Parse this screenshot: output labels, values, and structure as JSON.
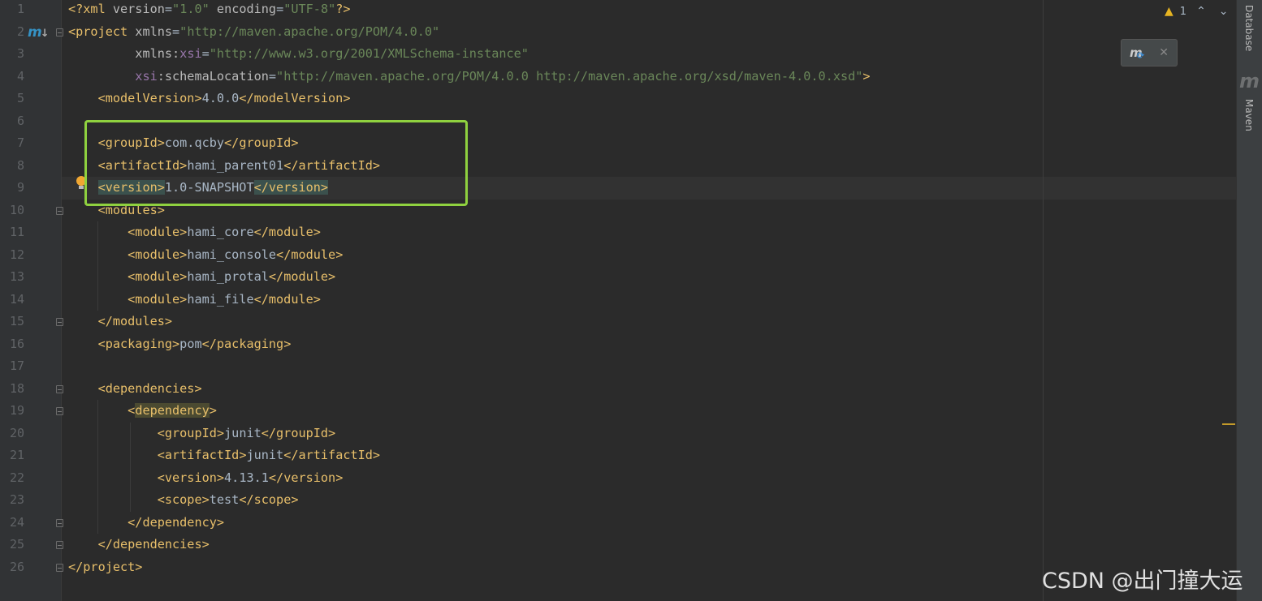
{
  "editor": {
    "lines": [
      {
        "num": "1",
        "parts": [
          {
            "c": "tag",
            "t": "<?xml "
          },
          {
            "c": "attr",
            "t": "version"
          },
          {
            "c": "txt",
            "t": "="
          },
          {
            "c": "val",
            "t": "\"1.0\""
          },
          {
            "c": "txt",
            "t": " "
          },
          {
            "c": "attr",
            "t": "encoding"
          },
          {
            "c": "txt",
            "t": "="
          },
          {
            "c": "val",
            "t": "\"UTF-8\""
          },
          {
            "c": "tag",
            "t": "?>"
          }
        ]
      },
      {
        "num": "2",
        "parts": [
          {
            "c": "tag",
            "t": "<project "
          },
          {
            "c": "attr",
            "t": "xmlns"
          },
          {
            "c": "txt",
            "t": "="
          },
          {
            "c": "val",
            "t": "\"http://maven.apache.org/POM/4.0.0\""
          }
        ]
      },
      {
        "num": "3",
        "parts": [
          {
            "c": "txt",
            "t": "         "
          },
          {
            "c": "attr",
            "t": "xmlns:"
          },
          {
            "c": "ns",
            "t": "xsi"
          },
          {
            "c": "txt",
            "t": "="
          },
          {
            "c": "val",
            "t": "\"http://www.w3.org/2001/XMLSchema-instance\""
          }
        ]
      },
      {
        "num": "4",
        "parts": [
          {
            "c": "txt",
            "t": "         "
          },
          {
            "c": "ns",
            "t": "xsi"
          },
          {
            "c": "attr",
            "t": ":schemaLocation"
          },
          {
            "c": "txt",
            "t": "="
          },
          {
            "c": "val",
            "t": "\"http://maven.apache.org/POM/4.0.0 http://maven.apache.org/xsd/maven-4.0.0.xsd\""
          },
          {
            "c": "tag",
            "t": ">"
          }
        ]
      },
      {
        "num": "5",
        "parts": [
          {
            "c": "txt",
            "t": "    "
          },
          {
            "c": "tag",
            "t": "<modelVersion>"
          },
          {
            "c": "txt",
            "t": "4.0.0"
          },
          {
            "c": "tag",
            "t": "</modelVersion>"
          }
        ]
      },
      {
        "num": "6",
        "parts": []
      },
      {
        "num": "7",
        "parts": [
          {
            "c": "txt",
            "t": "    "
          },
          {
            "c": "tag",
            "t": "<groupId>"
          },
          {
            "c": "txt",
            "t": "com.qcby"
          },
          {
            "c": "tag",
            "t": "</groupId>"
          }
        ]
      },
      {
        "num": "8",
        "parts": [
          {
            "c": "txt",
            "t": "    "
          },
          {
            "c": "tag",
            "t": "<artifactId>"
          },
          {
            "c": "txt",
            "t": "hami_parent01"
          },
          {
            "c": "tag",
            "t": "</artifactId>"
          }
        ]
      },
      {
        "num": "9",
        "parts": [
          {
            "c": "txt",
            "t": "    "
          },
          {
            "c": "tag match",
            "t": "<version>"
          },
          {
            "c": "txt",
            "t": "1.0-SNAPSHOT"
          },
          {
            "c": "tag match",
            "t": "</version>"
          }
        ]
      },
      {
        "num": "10",
        "parts": [
          {
            "c": "txt",
            "t": "    "
          },
          {
            "c": "tag",
            "t": "<modules>"
          }
        ]
      },
      {
        "num": "11",
        "parts": [
          {
            "c": "txt",
            "t": "        "
          },
          {
            "c": "tag",
            "t": "<module>"
          },
          {
            "c": "txt",
            "t": "hami_core"
          },
          {
            "c": "tag",
            "t": "</module>"
          }
        ]
      },
      {
        "num": "12",
        "parts": [
          {
            "c": "txt",
            "t": "        "
          },
          {
            "c": "tag",
            "t": "<module>"
          },
          {
            "c": "txt",
            "t": "hami_console"
          },
          {
            "c": "tag",
            "t": "</module>"
          }
        ]
      },
      {
        "num": "13",
        "parts": [
          {
            "c": "txt",
            "t": "        "
          },
          {
            "c": "tag",
            "t": "<module>"
          },
          {
            "c": "txt",
            "t": "hami_protal"
          },
          {
            "c": "tag",
            "t": "</module>"
          }
        ]
      },
      {
        "num": "14",
        "parts": [
          {
            "c": "txt",
            "t": "        "
          },
          {
            "c": "tag",
            "t": "<module>"
          },
          {
            "c": "txt",
            "t": "hami_file"
          },
          {
            "c": "tag",
            "t": "</module>"
          }
        ]
      },
      {
        "num": "15",
        "parts": [
          {
            "c": "txt",
            "t": "    "
          },
          {
            "c": "tag",
            "t": "</modules>"
          }
        ]
      },
      {
        "num": "16",
        "parts": [
          {
            "c": "txt",
            "t": "    "
          },
          {
            "c": "tag",
            "t": "<packaging>"
          },
          {
            "c": "txt",
            "t": "pom"
          },
          {
            "c": "tag",
            "t": "</packaging>"
          }
        ]
      },
      {
        "num": "17",
        "parts": []
      },
      {
        "num": "18",
        "parts": [
          {
            "c": "txt",
            "t": "    "
          },
          {
            "c": "tag",
            "t": "<dependencies>"
          }
        ]
      },
      {
        "num": "19",
        "parts": [
          {
            "c": "txt",
            "t": "        "
          },
          {
            "c": "tag",
            "t": "<"
          },
          {
            "c": "tag ident-hl",
            "t": "dependency"
          },
          {
            "c": "tag",
            "t": ">"
          }
        ]
      },
      {
        "num": "20",
        "parts": [
          {
            "c": "txt",
            "t": "            "
          },
          {
            "c": "tag",
            "t": "<groupId>"
          },
          {
            "c": "txt",
            "t": "junit"
          },
          {
            "c": "tag",
            "t": "</groupId>"
          }
        ]
      },
      {
        "num": "21",
        "parts": [
          {
            "c": "txt",
            "t": "            "
          },
          {
            "c": "tag",
            "t": "<artifactId>"
          },
          {
            "c": "txt",
            "t": "junit"
          },
          {
            "c": "tag",
            "t": "</artifactId>"
          }
        ]
      },
      {
        "num": "22",
        "parts": [
          {
            "c": "txt",
            "t": "            "
          },
          {
            "c": "tag",
            "t": "<version>"
          },
          {
            "c": "txt",
            "t": "4.13.1"
          },
          {
            "c": "tag",
            "t": "</version>"
          }
        ]
      },
      {
        "num": "23",
        "parts": [
          {
            "c": "txt",
            "t": "            "
          },
          {
            "c": "tag",
            "t": "<scope>"
          },
          {
            "c": "txt",
            "t": "test"
          },
          {
            "c": "tag",
            "t": "</scope>"
          }
        ]
      },
      {
        "num": "24",
        "parts": [
          {
            "c": "txt",
            "t": "        "
          },
          {
            "c": "tag",
            "t": "</dependency>"
          }
        ]
      },
      {
        "num": "25",
        "parts": [
          {
            "c": "txt",
            "t": "    "
          },
          {
            "c": "tag",
            "t": "</dependencies>"
          }
        ]
      },
      {
        "num": "26",
        "parts": [
          {
            "c": "tag",
            "t": "</project>"
          }
        ]
      }
    ],
    "current_line": "9",
    "fold_lines": [
      "2",
      "10",
      "15",
      "18",
      "19",
      "24",
      "25",
      "26"
    ]
  },
  "inspection": {
    "warning_count": "1",
    "prev_label": "⌃",
    "next_label": "⌄",
    "warning_icon": "warning-icon"
  },
  "maven_popup": {
    "icon": "maven-reload-icon",
    "icon_text": "m",
    "close_label": "✕"
  },
  "gutter_icon_text": "m",
  "sidebar": {
    "tabs": [
      "Database",
      "Maven"
    ],
    "maven_icon_text": "m"
  },
  "watermark": "CSDN @出门撞大运",
  "colors": {
    "highlight_box": "#8fd13f",
    "background": "#2b2b2b",
    "tag": "#e8bf6a",
    "string": "#6a8759"
  }
}
